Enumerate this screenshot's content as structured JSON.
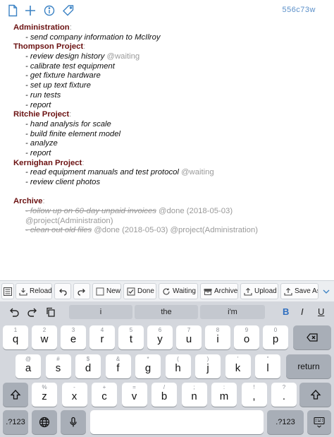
{
  "header": {
    "doc_id": "556c73w"
  },
  "document": {
    "projects": [
      {
        "name": "Administration",
        "tasks": [
          {
            "text": "send company information to McIlroy"
          }
        ]
      },
      {
        "name": "Thompson Project",
        "tasks": [
          {
            "text": "review design history",
            "tag": "@waiting"
          },
          {
            "text": "calibrate test equipment"
          },
          {
            "text": "get fixture hardware"
          },
          {
            "text": "set up text fixture"
          },
          {
            "text": "run tests"
          },
          {
            "text": "report"
          }
        ]
      },
      {
        "name": "Ritchie Project",
        "tasks": [
          {
            "text": "hand analysis for scale"
          },
          {
            "text": "build finite element model"
          },
          {
            "text": "analyze"
          },
          {
            "text": "report"
          }
        ]
      },
      {
        "name": "Kernighan Project",
        "tasks": [
          {
            "text": "read equipment manuals and test protocol",
            "tag": "@waiting"
          },
          {
            "text": "review client photos"
          }
        ]
      }
    ],
    "archive": {
      "name": "Archive",
      "items": [
        {
          "text": "follow up on 60-day unpaid invoices",
          "tag": "@done (2018-05-03)",
          "cont": "@project(Administration)"
        },
        {
          "text": "clean out old files",
          "tag": "@done (2018-05-03) @project(Administration)"
        }
      ]
    },
    "dash": "-",
    "colon": ":"
  },
  "toolbar": {
    "reload": "Reload",
    "new": "New",
    "done": "Done",
    "waiting": "Waiting",
    "archive": "Archive",
    "upload": "Upload",
    "save_as": "Save As..."
  },
  "keyboard": {
    "suggestions": [
      "i",
      "the",
      "i'm"
    ],
    "format": {
      "bold": "B",
      "italic": "I",
      "underline": "U"
    },
    "row1": [
      {
        "alt": "1",
        "main": "q"
      },
      {
        "alt": "2",
        "main": "w"
      },
      {
        "alt": "3",
        "main": "e"
      },
      {
        "alt": "4",
        "main": "r"
      },
      {
        "alt": "5",
        "main": "t"
      },
      {
        "alt": "6",
        "main": "y"
      },
      {
        "alt": "7",
        "main": "u"
      },
      {
        "alt": "8",
        "main": "i"
      },
      {
        "alt": "9",
        "main": "o"
      },
      {
        "alt": "0",
        "main": "p"
      }
    ],
    "row2": [
      {
        "alt": "@",
        "main": "a"
      },
      {
        "alt": "#",
        "main": "s"
      },
      {
        "alt": "$",
        "main": "d"
      },
      {
        "alt": "&",
        "main": "f"
      },
      {
        "alt": "*",
        "main": "g"
      },
      {
        "alt": "(",
        "main": "h"
      },
      {
        "alt": ")",
        "main": "j"
      },
      {
        "alt": "'",
        "main": "k"
      },
      {
        "alt": "\"",
        "main": "l"
      }
    ],
    "row3": [
      {
        "alt": "%",
        "main": "z"
      },
      {
        "alt": "-",
        "main": "x"
      },
      {
        "alt": "+",
        "main": "c"
      },
      {
        "alt": "=",
        "main": "v"
      },
      {
        "alt": "/",
        "main": "b"
      },
      {
        "alt": ";",
        "main": "n"
      },
      {
        "alt": ":",
        "main": "m"
      },
      {
        "alt": "!",
        "main": ","
      },
      {
        "alt": "?",
        "main": "."
      }
    ],
    "return": "return",
    "numbers": ".?123",
    "numbers_right": ".?123"
  }
}
